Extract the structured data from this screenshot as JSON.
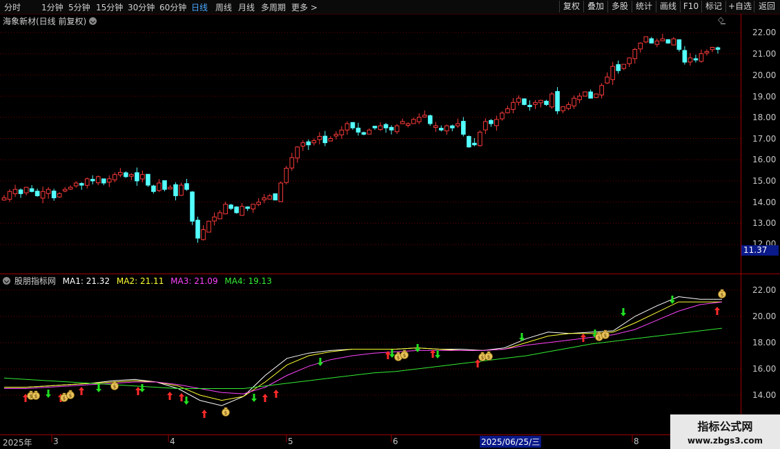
{
  "toolbar": {
    "timeframes": [
      "分时",
      "1分钟",
      "5分钟",
      "15分钟",
      "30分钟",
      "60分钟",
      "日线",
      "周线",
      "月线",
      "多周期",
      "更多 >"
    ],
    "active_timeframe": "日线",
    "buttons": [
      "复权",
      "叠加",
      "多股",
      "统计",
      "画线",
      "F10",
      "标记",
      "+自选",
      "返回"
    ]
  },
  "stock": {
    "title": "海象新材(日线 前复权)"
  },
  "price_axis": {
    "ticks": [
      "22.00",
      "21.00",
      "20.00",
      "19.00",
      "18.00",
      "17.00",
      "16.00",
      "15.00",
      "14.00",
      "13.00",
      "12.00"
    ],
    "current_price": "11.37"
  },
  "indicator": {
    "name": "股朋指标网",
    "ma1": "MA1: 21.32",
    "ma2": "MA2: 21.11",
    "ma3": "MA3: 21.09",
    "ma4": "MA4: 19.13",
    "axis_ticks": [
      "22.00",
      "20.00",
      "18.00",
      "16.00",
      "14.00"
    ]
  },
  "date_axis": {
    "labels": [
      "2025年",
      "3",
      "4",
      "5",
      "6",
      "8"
    ],
    "selected": "2025/06/25/三"
  },
  "watermark": {
    "title": "指标公式网",
    "url": "www.zbgs3.com"
  },
  "colors": {
    "up": "#ff3b3b",
    "down": "#54ffff",
    "ma1": "#ffffff",
    "ma2": "#ffff33",
    "ma3": "#ff44ff",
    "ma4": "#33ee33",
    "grid": "#7a0000"
  },
  "chart_data": [
    {
      "type": "candlestick",
      "title": "海象新材(日线 前复权)",
      "ylim": [
        11.5,
        22.3
      ],
      "close": [
        14.2,
        14.5,
        14.6,
        14.4,
        14.7,
        14.5,
        14.3,
        14.5,
        14.6,
        14.2,
        14.4,
        14.6,
        14.7,
        14.9,
        14.8,
        15.1,
        15.0,
        15.2,
        14.9,
        15.1,
        15.3,
        15.4,
        15.2,
        15.3,
        15.0,
        15.3,
        14.8,
        14.5,
        14.9,
        14.6,
        14.7,
        14.3,
        14.8,
        14.6,
        13.1,
        12.3,
        12.7,
        13.1,
        13.3,
        13.5,
        13.9,
        13.7,
        13.5,
        13.8,
        13.7,
        13.9,
        14.0,
        14.2,
        14.3,
        14.1,
        14.9,
        15.6,
        16.1,
        16.6,
        16.8,
        16.7,
        16.9,
        17.1,
        16.8,
        17.0,
        17.2,
        17.4,
        17.7,
        17.5,
        17.3,
        17.2,
        17.4,
        17.5,
        17.6,
        17.5,
        17.4,
        17.6,
        17.8,
        17.7,
        17.9,
        18.0,
        18.1,
        17.7,
        17.6,
        17.4,
        17.6,
        17.5,
        17.7,
        17.2,
        16.6,
        16.7,
        17.3,
        17.8,
        17.7,
        17.9,
        18.2,
        18.4,
        18.7,
        18.9,
        18.6,
        18.5,
        18.7,
        18.8,
        18.6,
        19.1,
        18.3,
        18.5,
        18.6,
        18.9,
        19.0,
        19.2,
        18.9,
        19.1,
        19.5,
        19.9,
        20.4,
        20.2,
        20.5,
        20.8,
        21.2,
        21.5,
        21.8,
        21.5,
        21.6,
        21.7,
        21.5,
        21.7,
        21.2,
        20.6,
        20.8,
        20.7,
        21.0,
        21.1,
        21.3,
        21.2
      ]
    },
    {
      "type": "line",
      "title": "股朋指标网",
      "ylim": [
        12.8,
        23.0
      ],
      "series": [
        {
          "name": "MA1",
          "values": [
            14.6,
            14.6,
            14.7,
            14.8,
            14.9,
            15.1,
            15.2,
            15.0,
            14.5,
            13.6,
            13.2,
            13.9,
            15.5,
            16.8,
            17.2,
            17.4,
            17.5,
            17.5,
            17.5,
            17.6,
            17.5,
            17.5,
            17.4,
            17.6,
            18.3,
            18.8,
            18.7,
            18.8,
            18.9,
            20.0,
            20.8,
            21.5,
            21.3,
            21.3
          ]
        },
        {
          "name": "MA2",
          "values": [
            14.6,
            14.6,
            14.7,
            14.8,
            14.9,
            15.0,
            15.1,
            15.0,
            14.7,
            14.0,
            13.6,
            13.9,
            15.0,
            16.3,
            17.0,
            17.3,
            17.5,
            17.5,
            17.5,
            17.6,
            17.5,
            17.4,
            17.4,
            17.5,
            18.0,
            18.5,
            18.7,
            18.7,
            18.8,
            19.5,
            20.3,
            21.1,
            21.1,
            21.1
          ]
        },
        {
          "name": "MA3",
          "values": [
            14.5,
            14.5,
            14.6,
            14.7,
            14.8,
            14.9,
            15.0,
            15.0,
            14.8,
            14.5,
            14.2,
            14.1,
            14.6,
            15.5,
            16.2,
            16.7,
            17.0,
            17.2,
            17.3,
            17.4,
            17.4,
            17.4,
            17.4,
            17.5,
            17.8,
            18.0,
            18.2,
            18.4,
            18.6,
            19.0,
            19.7,
            20.4,
            20.9,
            21.1
          ]
        },
        {
          "name": "MA4",
          "values": [
            15.3,
            15.2,
            15.1,
            15.0,
            14.9,
            14.8,
            14.7,
            14.6,
            14.5,
            14.5,
            14.5,
            14.5,
            14.7,
            14.9,
            15.1,
            15.3,
            15.5,
            15.7,
            15.8,
            16.0,
            16.2,
            16.4,
            16.6,
            16.8,
            17.0,
            17.3,
            17.6,
            17.9,
            18.1,
            18.3,
            18.5,
            18.7,
            18.9,
            19.1
          ]
        }
      ]
    }
  ]
}
